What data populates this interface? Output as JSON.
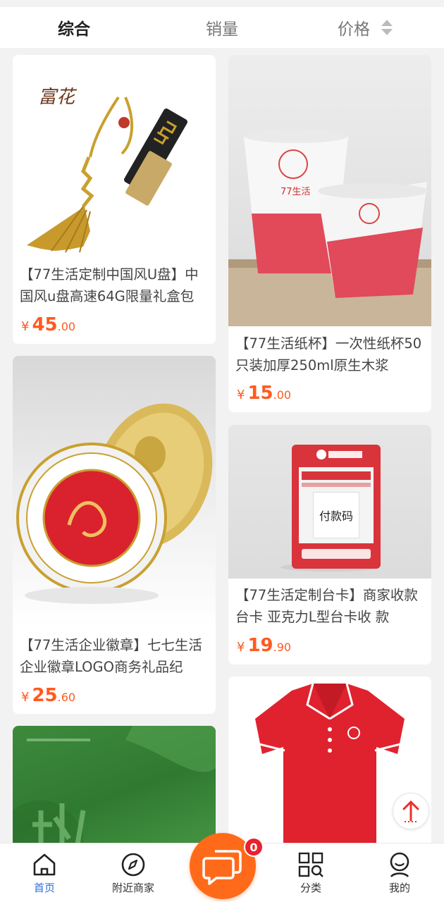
{
  "sort_bar": {
    "tabs": [
      {
        "label": "综合"
      },
      {
        "label": "销量"
      },
      {
        "label": "价格"
      }
    ]
  },
  "products": [
    {
      "title": "【77生活定制中国风U盘】中国风u盘高速64G限量礼盒包",
      "price_symbol": "¥",
      "price_int": "45",
      "price_dec": ".00",
      "image": "gold-usb-drive-with-tassel",
      "image_text": "富花"
    },
    {
      "title": "【77生活纸杯】一次性纸杯50只装加厚250ml原生木浆",
      "price_symbol": "¥",
      "price_int": "15",
      "price_dec": ".00",
      "image": "red-white-paper-cups",
      "image_text": "77生活"
    },
    {
      "title": "【77生活企业徽章】七七生活企业徽章LOGO商务礼品纪",
      "price_symbol": "¥",
      "price_int": "25",
      "price_dec": ".60",
      "image": "enamel-company-badge"
    },
    {
      "title": "【77生活定制台卡】商家收款台卡 亚克力L型台卡收 款",
      "price_symbol": "¥",
      "price_int": "19",
      "price_dec": ".90",
      "image": "red-acrylic-payment-stand",
      "image_text": "付款码"
    },
    {
      "title": "",
      "image": "green-book-cover"
    },
    {
      "title": "",
      "image": "red-polo-shirt"
    }
  ],
  "bottom_nav": {
    "items": [
      {
        "label": "首页",
        "icon": "home-icon"
      },
      {
        "label": "附近商家",
        "icon": "compass-icon"
      },
      {
        "label": "分类",
        "icon": "category-search-icon"
      },
      {
        "label": "我的",
        "icon": "profile-icon"
      }
    ],
    "chat_badge": "0"
  },
  "colors": {
    "price": "#ff5a1f",
    "active_tab": "#2e6fd8",
    "fab": "#ff6a1a",
    "badge": "#e8222e"
  }
}
